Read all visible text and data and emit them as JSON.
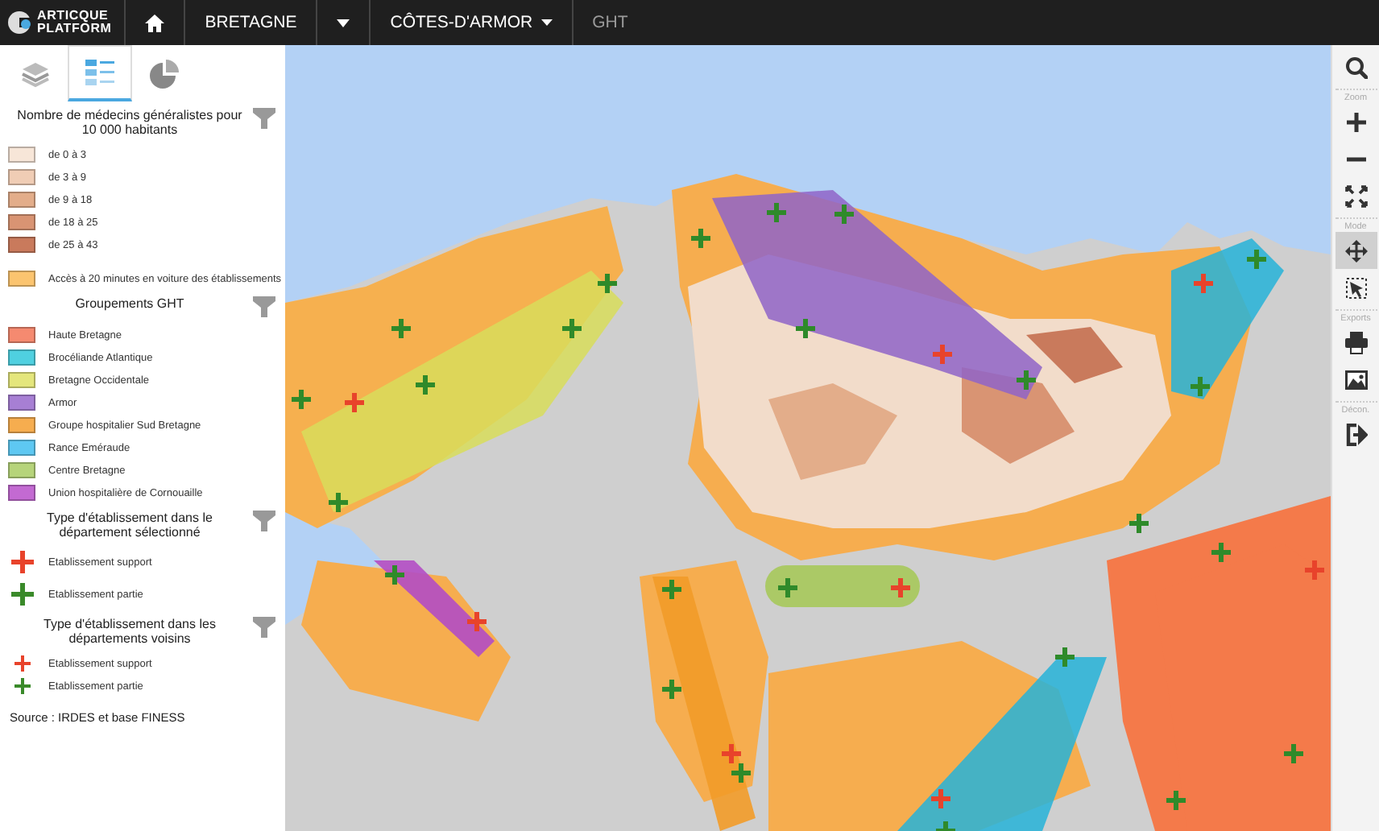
{
  "top_bar": {
    "logo": {
      "line_1": "ARTICQUE",
      "line_2": "PLATFORM"
    },
    "breadcrumb": [
      {
        "kind": "home"
      },
      {
        "kind": "text",
        "label": "BRETAGNE",
        "active": true
      },
      {
        "kind": "caret"
      },
      {
        "kind": "dropdown",
        "label": "CÔTES-D'ARMOR",
        "active": true
      },
      {
        "kind": "text",
        "label": "GHT",
        "active": false
      }
    ]
  },
  "sidebar": {
    "tabs": [
      {
        "kind": "layers",
        "selected": false
      },
      {
        "kind": "legend",
        "selected": true
      },
      {
        "kind": "chart",
        "selected": false
      }
    ],
    "legend": [
      {
        "title": "Nombre de médecins généralistes pour 10 000 habitants",
        "items": [
          {
            "kind": "swatch",
            "label": "de 0 à 3",
            "color": "#f7e6d8"
          },
          {
            "kind": "swatch",
            "label": "de 3 à 9",
            "color": "#f0cdb5"
          },
          {
            "kind": "swatch",
            "label": "de 9 à 18",
            "color": "#e3ad8a"
          },
          {
            "kind": "swatch",
            "label": "de 18 à 25",
            "color": "#d99473"
          },
          {
            "kind": "swatch",
            "label": "de 25 à 43",
            "color": "#c97a5c"
          },
          {
            "kind": "gap"
          },
          {
            "kind": "swatch",
            "label": "Accès à 20 minutes en voiture des établissements",
            "color": "#fbc46f"
          }
        ]
      },
      {
        "title": "Groupements GHT",
        "items": [
          {
            "kind": "swatch",
            "label": "Haute Bretagne",
            "color": "#f58a70"
          },
          {
            "kind": "swatch",
            "label": "Brocéliande Atlantique",
            "color": "#4fd0e0"
          },
          {
            "kind": "swatch",
            "label": "Bretagne Occidentale",
            "color": "#e4e67c"
          },
          {
            "kind": "swatch",
            "label": "Armor",
            "color": "#a77fd4"
          },
          {
            "kind": "swatch",
            "label": "Groupe hospitalier Sud Bretagne",
            "color": "#f6ad4f"
          },
          {
            "kind": "swatch",
            "label": "Rance Eméraude",
            "color": "#5ec8f2"
          },
          {
            "kind": "swatch",
            "label": "Centre Bretagne",
            "color": "#b6d47a"
          },
          {
            "kind": "swatch",
            "label": "Union hospitalière de Cornouaille",
            "color": "#c36ad2"
          }
        ]
      },
      {
        "title": "Type d'établissement dans le département sélectionné",
        "items": [
          {
            "kind": "cross-large",
            "label": "Etablissement support",
            "color": "#e8432b"
          },
          {
            "kind": "cross-large",
            "label": "Etablissement partie",
            "color": "#3a8a2a"
          }
        ]
      },
      {
        "title": "Type d'établissement dans les départements voisins",
        "items": [
          {
            "kind": "cross-small",
            "label": "Etablissement support",
            "color": "#e8432b"
          },
          {
            "kind": "cross-small",
            "label": "Etablissement partie",
            "color": "#3a8a2a"
          }
        ]
      }
    ],
    "source": "Source : IRDES et base FINESS"
  },
  "toolbar": [
    {
      "kind": "search",
      "selected": false
    },
    {
      "kind": "label",
      "label": "Zoom"
    },
    {
      "kind": "zoom-in",
      "selected": false
    },
    {
      "kind": "zoom-out",
      "selected": false
    },
    {
      "kind": "fit",
      "selected": false
    },
    {
      "kind": "label",
      "label": "Mode"
    },
    {
      "kind": "move",
      "selected": true
    },
    {
      "kind": "select",
      "selected": false
    },
    {
      "kind": "label",
      "label": "Exports"
    },
    {
      "kind": "print",
      "selected": false
    },
    {
      "kind": "image",
      "selected": false
    },
    {
      "kind": "label",
      "label": "Décon."
    },
    {
      "kind": "logout",
      "selected": false
    }
  ]
}
